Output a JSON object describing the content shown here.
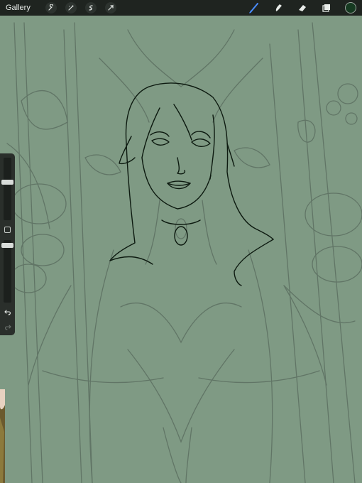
{
  "topbar": {
    "gallery_label": "Gallery",
    "left_tools": [
      "wrench-icon",
      "magic-wand-icon",
      "selection-icon",
      "transform-arrow-icon"
    ],
    "right_tools": [
      "brush-icon",
      "smudge-icon",
      "eraser-icon",
      "layers-icon"
    ],
    "active_tool": "brush-icon",
    "active_color": "#163a21",
    "accent_color": "#4a8dff"
  },
  "sidebar": {
    "brush_size_level": 0.62,
    "opacity_level": 0.95,
    "controls": [
      "brush-size-slider",
      "modify-button",
      "opacity-slider",
      "undo-icon",
      "redo-icon"
    ]
  },
  "canvas": {
    "background_color": "#7f9a84",
    "sketch_color": "#5e7263",
    "lineart_color": "#0d1a10"
  }
}
